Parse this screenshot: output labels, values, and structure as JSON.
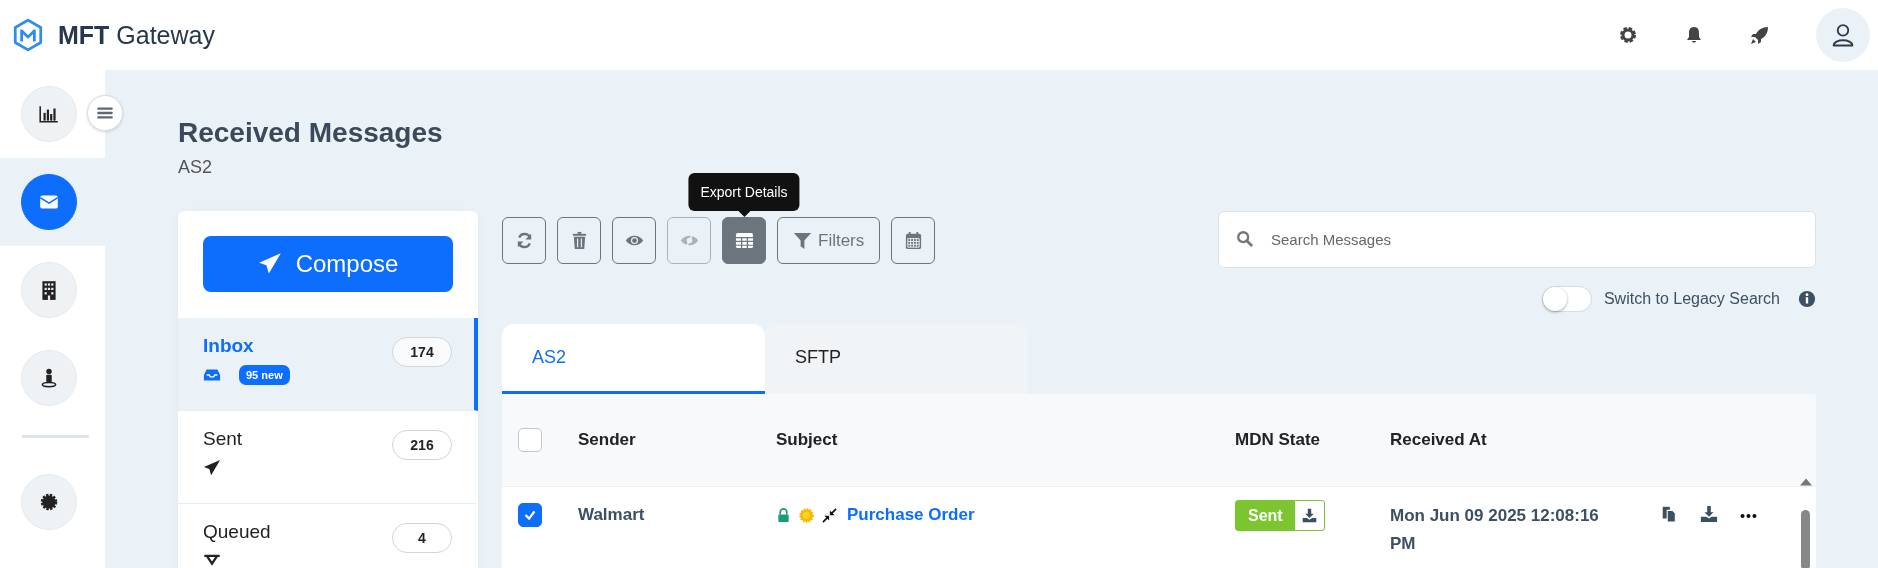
{
  "app": {
    "brand_bold": "MFT",
    "brand": "Gateway"
  },
  "rail": [
    {
      "kind": "dashboard",
      "selected": false
    },
    {
      "kind": "messages",
      "selected": true
    },
    {
      "kind": "organizations",
      "selected": false
    },
    {
      "kind": "partners",
      "selected": false
    },
    {
      "kind": "certificates",
      "selected": false
    }
  ],
  "page": {
    "title": "Received Messages",
    "subtitle": "AS2"
  },
  "compose": {
    "label": "Compose"
  },
  "folders": [
    {
      "kind": "inbox",
      "label": "Inbox",
      "count": "174",
      "badge": "95 new",
      "selected": true
    },
    {
      "kind": "sent",
      "label": "Sent",
      "count": "216",
      "selected": false
    },
    {
      "kind": "queued",
      "label": "Queued",
      "count": "4",
      "selected": false
    }
  ],
  "toolbar": [
    {
      "kind": "refresh",
      "active": false,
      "disabled": false
    },
    {
      "kind": "delete",
      "active": false,
      "disabled": false
    },
    {
      "kind": "mark-read",
      "active": false,
      "disabled": false
    },
    {
      "kind": "mark-unread",
      "active": false,
      "disabled": true
    },
    {
      "kind": "export",
      "active": true,
      "disabled": false,
      "tooltip": "Export Details"
    },
    {
      "kind": "filters",
      "label": "Filters",
      "active": false,
      "disabled": false
    },
    {
      "kind": "calendar",
      "active": false,
      "disabled": false
    }
  ],
  "search": {
    "placeholder": "Search Messages"
  },
  "legacy_toggle": {
    "label": "Switch to Legacy Search",
    "on": false
  },
  "tabs": [
    {
      "label": "AS2",
      "selected": true
    },
    {
      "label": "SFTP",
      "selected": false
    }
  ],
  "table": {
    "columns": [
      "Sender",
      "Subject",
      "MDN State",
      "Received At"
    ],
    "all_checked": false,
    "rows": [
      {
        "checked": true,
        "sender": "Walmart",
        "subject": "Purchase Order",
        "mdn_state": "Sent",
        "received_at": "Mon Jun 09 2025 12:08:16 PM"
      }
    ]
  }
}
